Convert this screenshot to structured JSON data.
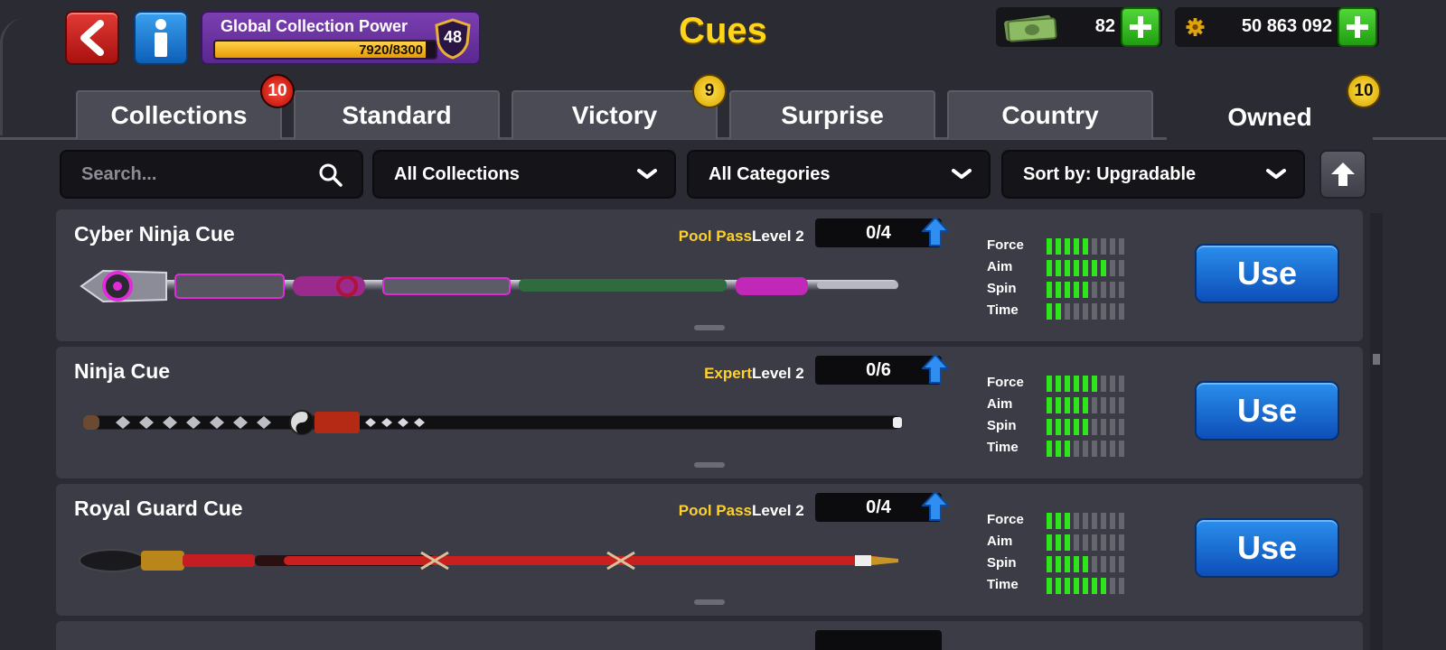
{
  "header": {
    "title": "Cues",
    "back_icon": "chevron-left-icon",
    "info_icon": "info-icon",
    "power": {
      "label": "Global Collection Power",
      "value_text": "7920/8300",
      "progress": 0.954,
      "level": "48"
    },
    "cash": {
      "icon": "cash-icon",
      "value": "82"
    },
    "coins": {
      "icon": "coin-gear-icon",
      "value": "50 863 092"
    },
    "colors": {
      "title": "#ffd51c",
      "add": "#2cb81a",
      "back": "#d0221e",
      "info": "#1f7fd8"
    }
  },
  "tabs": [
    {
      "label": "Collections",
      "badge": "10",
      "badge_color": "red"
    },
    {
      "label": "Standard",
      "badge": ""
    },
    {
      "label": "Victory",
      "badge": "9",
      "badge_color": "yellow"
    },
    {
      "label": "Surprise",
      "badge": ""
    },
    {
      "label": "Country",
      "badge": ""
    },
    {
      "label": "Owned",
      "badge": "10",
      "badge_color": "yellow",
      "active": true
    }
  ],
  "filters": {
    "search_placeholder": "Search...",
    "collections": "All Collections",
    "categories": "All Categories",
    "sort": "Sort by: Upgradable",
    "sort_direction_icon": "arrow-up-icon"
  },
  "stat_labels": [
    "Force",
    "Aim",
    "Spin",
    "Time"
  ],
  "cues": [
    {
      "name": "Cyber Ninja Cue",
      "tag": "Pool Pass",
      "level": "Level 2",
      "progress": "0/4",
      "stats": [
        5,
        7,
        5,
        2
      ],
      "use_label": "Use"
    },
    {
      "name": "Ninja Cue",
      "tag": "Expert",
      "level": "Level 2",
      "progress": "0/6",
      "stats": [
        6,
        5,
        5,
        3
      ],
      "use_label": "Use"
    },
    {
      "name": "Royal Guard Cue",
      "tag": "Pool Pass",
      "level": "Level 2",
      "progress": "0/4",
      "stats": [
        3,
        3,
        5,
        7
      ],
      "use_label": "Use"
    }
  ],
  "stat_max": 9
}
